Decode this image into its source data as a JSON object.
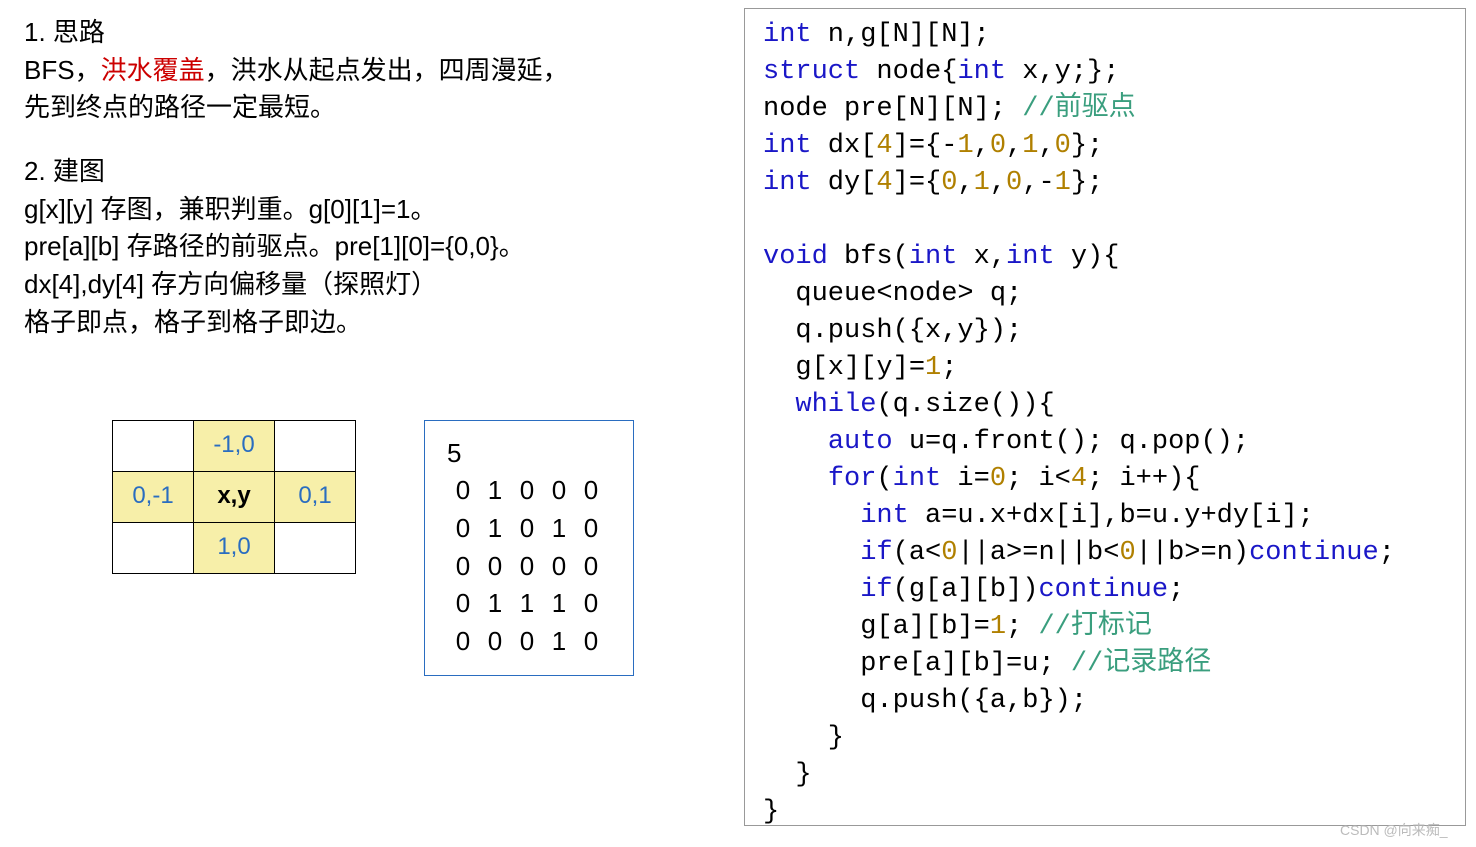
{
  "left": {
    "h1": "1. 思路",
    "line2_pre": "BFS，",
    "line2_red": "洪水覆盖",
    "line2_post": "，洪水从起点发出，四周漫延，",
    "line3": "先到终点的路径一定最短。",
    "h2": "2. 建图",
    "g_line": "g[x][y] 存图，兼职判重。g[0][1]=1。",
    "pre_line": "pre[a][b] 存路径的前驱点。pre[1][0]={0,0}。",
    "dxdy_line": "dx[4],dy[4] 存方向偏移量（探照灯）",
    "grid_line": "格子即点，格子到格子即边。"
  },
  "dir_table": {
    "up": "-1,0",
    "left": "0,-1",
    "center": "x,y",
    "right": "0,1",
    "down": "1,0"
  },
  "matrix": {
    "n": "5",
    "rows": [
      [
        "0",
        "1",
        "0",
        "0",
        "0"
      ],
      [
        "0",
        "1",
        "0",
        "1",
        "0"
      ],
      [
        "0",
        "0",
        "0",
        "0",
        "0"
      ],
      [
        "0",
        "1",
        "1",
        "1",
        "0"
      ],
      [
        "0",
        "0",
        "0",
        "1",
        "0"
      ]
    ]
  },
  "code": {
    "l1a": "int",
    "l1b": " n,g[N][N];",
    "l2a": "struct",
    "l2b": " node{",
    "l2c": "int",
    "l2d": " x,y;};",
    "l3a": "node pre[N][N]; ",
    "l3c": "//前驱点",
    "l4a": "int",
    "l4b": " dx[",
    "l4n": "4",
    "l4c": "]={-",
    "l4d": "1",
    "l4e": ",",
    "l4f": "0",
    "l4g": ",",
    "l4h": "1",
    "l4i": ",",
    "l4j": "0",
    "l4k": "};",
    "l5a": "int",
    "l5b": " dy[",
    "l5n": "4",
    "l5c": "]={",
    "l5d": "0",
    "l5e": ",",
    "l5f": "1",
    "l5g": ",",
    "l5h": "0",
    "l5i": ",-",
    "l5j": "1",
    "l5k": "};",
    "l7a": "void",
    "l7b": " bfs(",
    "l7c": "int",
    "l7d": " x,",
    "l7e": "int",
    "l7f": " y){",
    "l8": "  queue<node> q;",
    "l9": "  q.push({x,y});",
    "l10a": "  g[x][y]=",
    "l10n": "1",
    "l10b": ";",
    "l11a": "  ",
    "l11b": "while",
    "l11c": "(q.size()){",
    "l12a": "    ",
    "l12b": "auto",
    "l12c": " u=q.front(); q.pop();",
    "l13a": "    ",
    "l13b": "for",
    "l13c": "(",
    "l13d": "int",
    "l13e": " i=",
    "l13f": "0",
    "l13g": "; i<",
    "l13h": "4",
    "l13i": "; i++){",
    "l14": "      int a=u.x+dx[i],b=u.y+dy[i];",
    "l14kw": "int",
    "l14pre": "      ",
    "l14post": " a=u.x+dx[i],b=u.y+dy[i];",
    "l15a": "      ",
    "l15b": "if",
    "l15c": "(a<",
    "l15d": "0",
    "l15e": "||a>=n||b<",
    "l15f": "0",
    "l15g": "||b>=n)",
    "l15h": "continue",
    "l15i": ";",
    "l16a": "      ",
    "l16b": "if",
    "l16c": "(g[a][b])",
    "l16d": "continue",
    "l16e": ";",
    "l17a": "      g[a][b]=",
    "l17n": "1",
    "l17b": "; ",
    "l17c": "//打标记",
    "l18a": "      pre[a][b]=u; ",
    "l18c": "//记录路径",
    "l19": "      q.push({a,b});",
    "l20": "    }",
    "l21": "  }",
    "l22": "}"
  },
  "watermark": "CSDN @向来痴_"
}
